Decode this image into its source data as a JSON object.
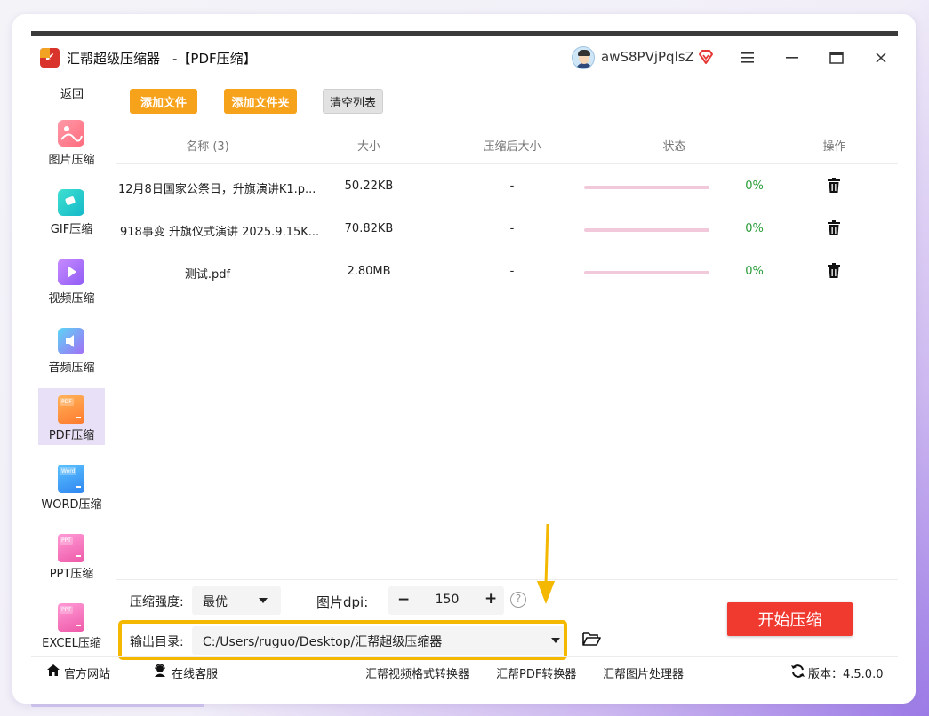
{
  "window": {
    "app_title": "汇帮超级压缩器",
    "mode_title": "-【PDF压缩】",
    "username": "awS8PVjPqlsZ",
    "accent_color": "#f7a21b",
    "icons": {
      "minimize": "minimize-icon",
      "maximize": "maximize-icon",
      "close": "close-icon",
      "menu": "hamburger-menu-icon",
      "vip": "vip-diamond-icon"
    }
  },
  "sidebar": {
    "back_label": "返回",
    "items": [
      {
        "label": "图片压缩",
        "icon": "image-compress-icon"
      },
      {
        "label": "GIF压缩",
        "icon": "gif-compress-icon"
      },
      {
        "label": "视频压缩",
        "icon": "video-compress-icon"
      },
      {
        "label": "音频压缩",
        "icon": "audio-compress-icon"
      },
      {
        "label": "PDF压缩",
        "icon": "pdf-compress-icon",
        "tag": "PDF",
        "active": true
      },
      {
        "label": "WORD压缩",
        "icon": "word-compress-icon",
        "tag": "Word"
      },
      {
        "label": "PPT压缩",
        "icon": "ppt-compress-icon",
        "tag": "PPT"
      },
      {
        "label": "EXCEL压缩",
        "icon": "excel-compress-icon",
        "tag": "PPT"
      }
    ]
  },
  "toolbar": {
    "add_file": "添加文件",
    "add_folder": "添加文件夹",
    "clear_list": "清空列表"
  },
  "table": {
    "headers": {
      "name": "名称 (3)",
      "size": "大小",
      "compressed_size": "压缩后大小",
      "status": "状态",
      "action": "操作"
    },
    "rows": [
      {
        "name": "12月8日国家公祭日，升旗演讲K1.p...",
        "size": "50.22KB",
        "compressed": "-",
        "progress": 0,
        "percent": "0%"
      },
      {
        "name": "918事变 升旗仪式演讲 2025.9.15K...",
        "size": "70.82KB",
        "compressed": "-",
        "progress": 0,
        "percent": "0%"
      },
      {
        "name": "测试.pdf",
        "size": "2.80MB",
        "compressed": "-",
        "progress": 0,
        "percent": "0%"
      }
    ]
  },
  "settings": {
    "strength_label": "压缩强度:",
    "strength_value": "最优",
    "dpi_label": "图片dpi:",
    "dpi_minus": "−",
    "dpi_value": "150",
    "dpi_plus": "+",
    "help": "?",
    "output_label": "输出目录:",
    "output_path": "C:/Users/ruguo/Desktop/汇帮超级压缩器",
    "start_button": "开始压缩"
  },
  "statusbar": {
    "official_site": "官方网站",
    "online_service": "在线客服",
    "video_converter": "汇帮视频格式转换器",
    "pdf_converter": "汇帮PDF转换器",
    "image_processor": "汇帮图片处理器",
    "version": "版本：4.5.0.0"
  }
}
